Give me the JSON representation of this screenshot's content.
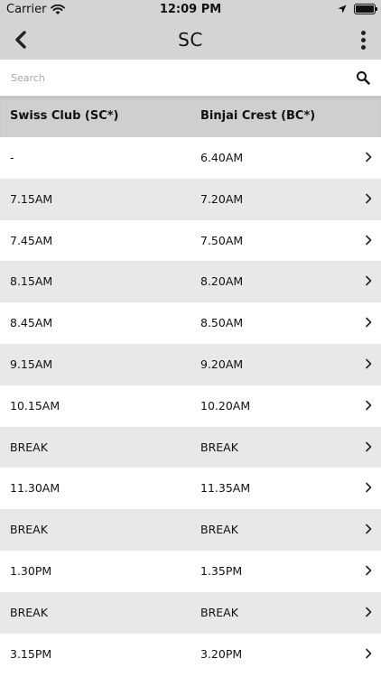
{
  "status_bar": {
    "carrier": "Carrier",
    "time": "12:09 PM"
  },
  "nav": {
    "title": "SC"
  },
  "search": {
    "placeholder": "Search"
  },
  "table": {
    "columns": [
      "Swiss Club (SC*)",
      "Binjai Crest (BC*)"
    ],
    "rows": [
      [
        "-",
        "6.40AM"
      ],
      [
        "7.15AM",
        "7.20AM"
      ],
      [
        "7.45AM",
        "7.50AM"
      ],
      [
        "8.15AM",
        "8.20AM"
      ],
      [
        "8.45AM",
        "8.50AM"
      ],
      [
        "9.15AM",
        "9.20AM"
      ],
      [
        "10.15AM",
        "10.20AM"
      ],
      [
        "BREAK",
        "BREAK"
      ],
      [
        "11.30AM",
        "11.35AM"
      ],
      [
        "BREAK",
        "BREAK"
      ],
      [
        "1.30PM",
        "1.35PM"
      ],
      [
        "BREAK",
        "BREAK"
      ],
      [
        "3.15PM",
        "3.20PM"
      ]
    ]
  },
  "colors": {
    "header_bg": "#d4d4d4",
    "row_alt": "#e8e8e8"
  }
}
